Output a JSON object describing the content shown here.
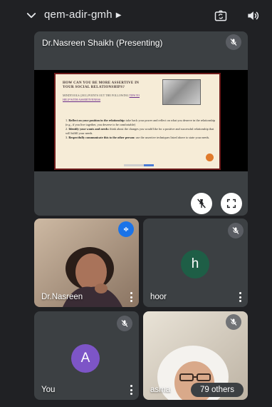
{
  "meeting": {
    "code": "qem-adir-gmh"
  },
  "icons": {
    "collapse": "chevron-down-icon",
    "switch_camera": "camera-switch-icon",
    "audio": "speaker-icon"
  },
  "presentation": {
    "label": "Dr.Nasreen Shaikh (Presenting)",
    "slide": {
      "title": "HOW CAN YOU BE MORE ASSERTIVE IN YOUR SOCIAL RELATIONSHIPS?",
      "subtitle_pre": "MINDTOOLS (2011) POINTS OUT THE FOLLOWING ",
      "subtitle_link": "TIPS TO HELP WITH ASSERTIVENESS",
      "items": [
        {
          "num": "1.",
          "bold": "Reflect on your position in the relationship:",
          "text": " take back your power and reflect on what you deserve in the relationship (e.g., if you live together, you deserve to be comfortable)"
        },
        {
          "num": "2.",
          "bold": "Identify your wants and needs:",
          "text": " think about the changes you would like for a positive and successful relationship that will fulfill your needs."
        },
        {
          "num": "3.",
          "bold": "Respectfully communicate this to the other person:",
          "text": " use the assertive techniques listed above to state your needs."
        }
      ]
    }
  },
  "participants": [
    {
      "name": "Dr.Nasreen",
      "muted": false,
      "speaking": true,
      "video": true
    },
    {
      "name": "hoor",
      "initial": "h",
      "muted": true,
      "avatar_color": "#1e5e46"
    },
    {
      "name": "You",
      "initial": "A",
      "muted": true,
      "avatar_color": "#7d55c7"
    },
    {
      "name": "asma",
      "muted": true,
      "video": true
    }
  ],
  "others_count": "79 others",
  "colors": {
    "background": "#202124",
    "tile": "#3c4043",
    "speaking_badge": "#1a73e8"
  }
}
